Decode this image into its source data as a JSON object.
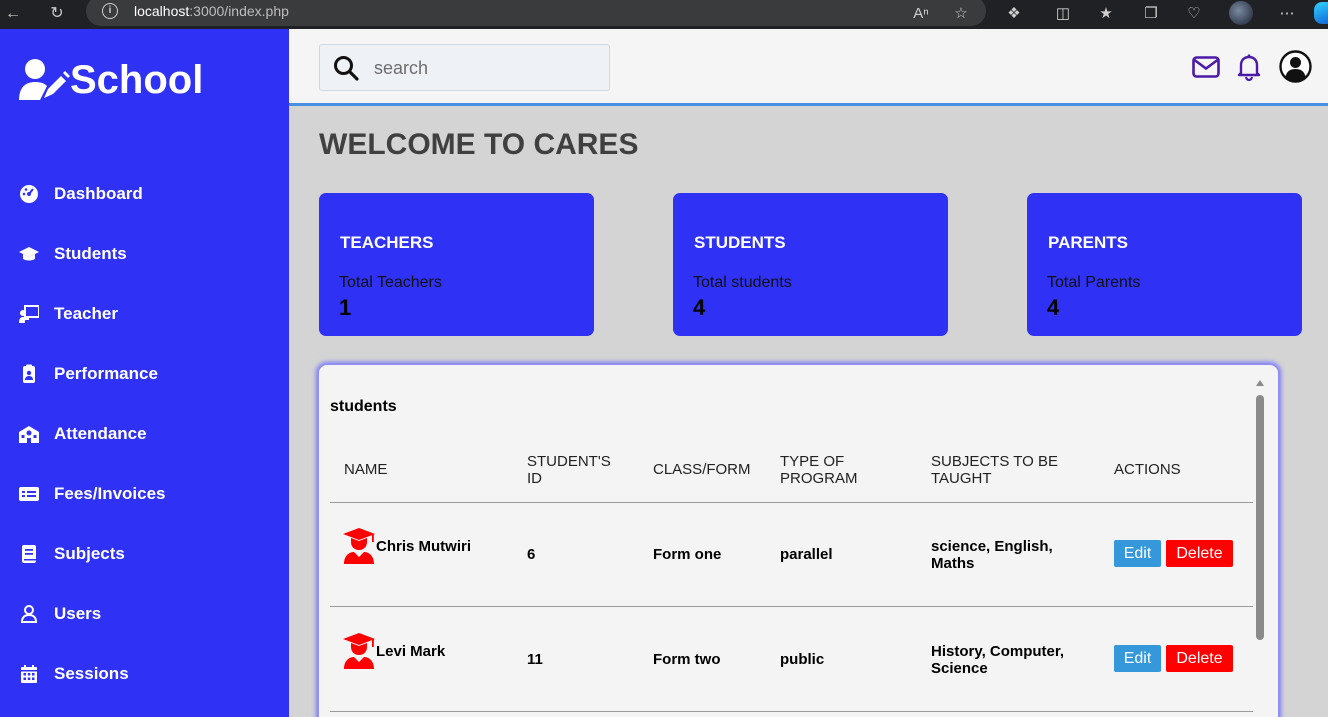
{
  "browser": {
    "url_host": "localhost",
    "url_rest": ":3000/index.php"
  },
  "sidebar": {
    "brand": "School",
    "items": [
      {
        "label": "Dashboard"
      },
      {
        "label": "Students"
      },
      {
        "label": "Teacher"
      },
      {
        "label": "Performance"
      },
      {
        "label": "Attendance"
      },
      {
        "label": "Fees/Invoices"
      },
      {
        "label": "Subjects"
      },
      {
        "label": "Users"
      },
      {
        "label": "Sessions"
      }
    ]
  },
  "header": {
    "search_placeholder": "search"
  },
  "main": {
    "welcome": "WELCOME TO CARES",
    "cards": [
      {
        "title": "TEACHERS",
        "subtitle": "Total Teachers",
        "value": "1"
      },
      {
        "title": "STUDENTS",
        "subtitle": "Total students",
        "value": "4"
      },
      {
        "title": "PARENTS",
        "subtitle": "Total Parents",
        "value": "4"
      }
    ],
    "table": {
      "title": "students",
      "columns": [
        "NAME",
        "STUDENT'S ID",
        "CLASS/FORM",
        "TYPE OF PROGRAM",
        "SUBJECTS TO BE TAUGHT",
        "ACTIONS"
      ],
      "rows": [
        {
          "name": "Chris Mutwiri",
          "id": "6",
          "class": "Form one",
          "program": "parallel",
          "subjects": "science, English, Maths",
          "edit": "Edit",
          "delete": "Delete"
        },
        {
          "name": "Levi Mark",
          "id": "11",
          "class": "Form two",
          "program": "public",
          "subjects": "History, Computer, Science",
          "edit": "Edit",
          "delete": "Delete"
        }
      ]
    }
  },
  "colors": {
    "sidebar_bg": "#2f31f5",
    "card_bg": "#2f31f5",
    "edit_btn": "#3498db",
    "delete_btn": "#ff0000",
    "avatar": "#ff0000"
  }
}
